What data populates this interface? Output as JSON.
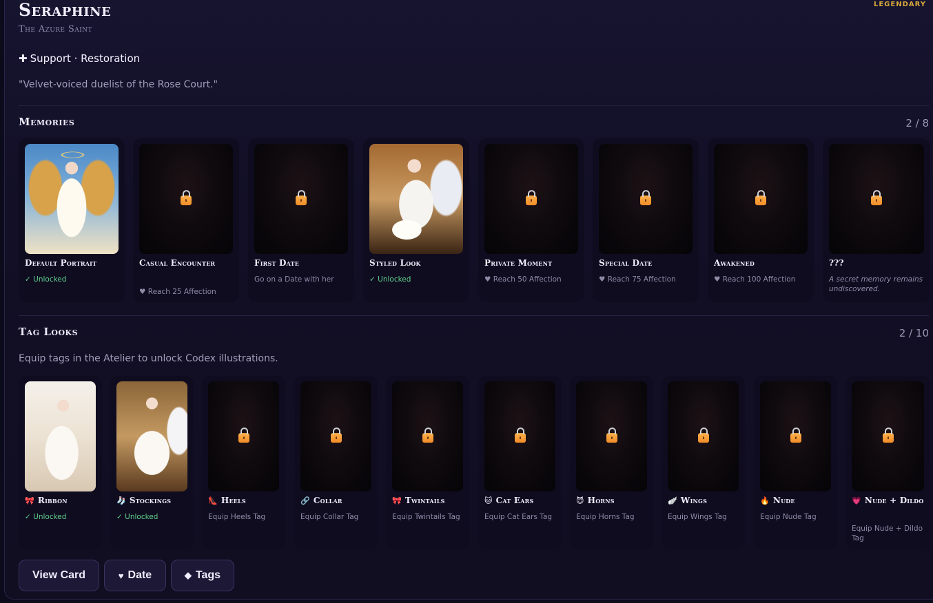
{
  "character": {
    "name": "Seraphine",
    "rarity": "LEGENDARY",
    "subtitle": "The Azure Saint",
    "role": "Support · Restoration",
    "quote": "\"Velvet-voiced duelist of the Rose Court.\""
  },
  "memories": {
    "title": "Memories",
    "count": "2 / 8",
    "items": [
      {
        "title": "Default Portrait",
        "status": "✓ Unlocked",
        "unlocked": true
      },
      {
        "title": "Casual Encounter",
        "status": "♥ Reach 25 Affection",
        "unlocked": false
      },
      {
        "title": "First Date",
        "status": "Go on a Date with her",
        "unlocked": false
      },
      {
        "title": "Styled Look",
        "status": "✓ Unlocked",
        "unlocked": true
      },
      {
        "title": "Private Moment",
        "status": "♥ Reach 50 Affection",
        "unlocked": false
      },
      {
        "title": "Special Date",
        "status": "♥ Reach 75 Affection",
        "unlocked": false
      },
      {
        "title": "Awakened",
        "status": "♥ Reach 100 Affection",
        "unlocked": false
      },
      {
        "title": "???",
        "status": "A secret memory remains undiscovered.",
        "unlocked": false
      }
    ]
  },
  "tag_looks": {
    "title": "Tag Looks",
    "count": "2 / 10",
    "hint": "Equip tags in the Atelier to unlock Codex illustrations.",
    "items": [
      {
        "icon": "🎀",
        "title": "Ribbon",
        "status": "✓ Unlocked",
        "unlocked": true
      },
      {
        "icon": "🧦",
        "title": "Stockings",
        "status": "✓ Unlocked",
        "unlocked": true
      },
      {
        "icon": "👠",
        "title": "Heels",
        "status": "Equip Heels Tag",
        "unlocked": false
      },
      {
        "icon": "🔗",
        "title": "Collar",
        "status": "Equip Collar Tag",
        "unlocked": false
      },
      {
        "icon": "🎀",
        "title": "Twintails",
        "status": "Equip Twintails Tag",
        "unlocked": false
      },
      {
        "icon": "🐱",
        "title": "Cat Ears",
        "status": "Equip Cat Ears Tag",
        "unlocked": false
      },
      {
        "icon": "😈",
        "title": "Horns",
        "status": "Equip Horns Tag",
        "unlocked": false
      },
      {
        "icon": "🪽",
        "title": "Wings",
        "status": "Equip Wings Tag",
        "unlocked": false
      },
      {
        "icon": "🔥",
        "title": "Nude",
        "status": "Equip Nude Tag",
        "unlocked": false
      },
      {
        "icon": "💗",
        "title": "Nude + Dildo",
        "status": "Equip Nude + Dildo Tag",
        "unlocked": false
      }
    ]
  },
  "actions": {
    "view_card": "View Card",
    "date_icon": "♥",
    "date": "Date",
    "tags_icon": "◆",
    "tags": "Tags"
  },
  "colors": {
    "accent_gold": "#d9a93b",
    "unlocked_green": "#5fd08a",
    "lock_orange": "#f5a03a"
  }
}
